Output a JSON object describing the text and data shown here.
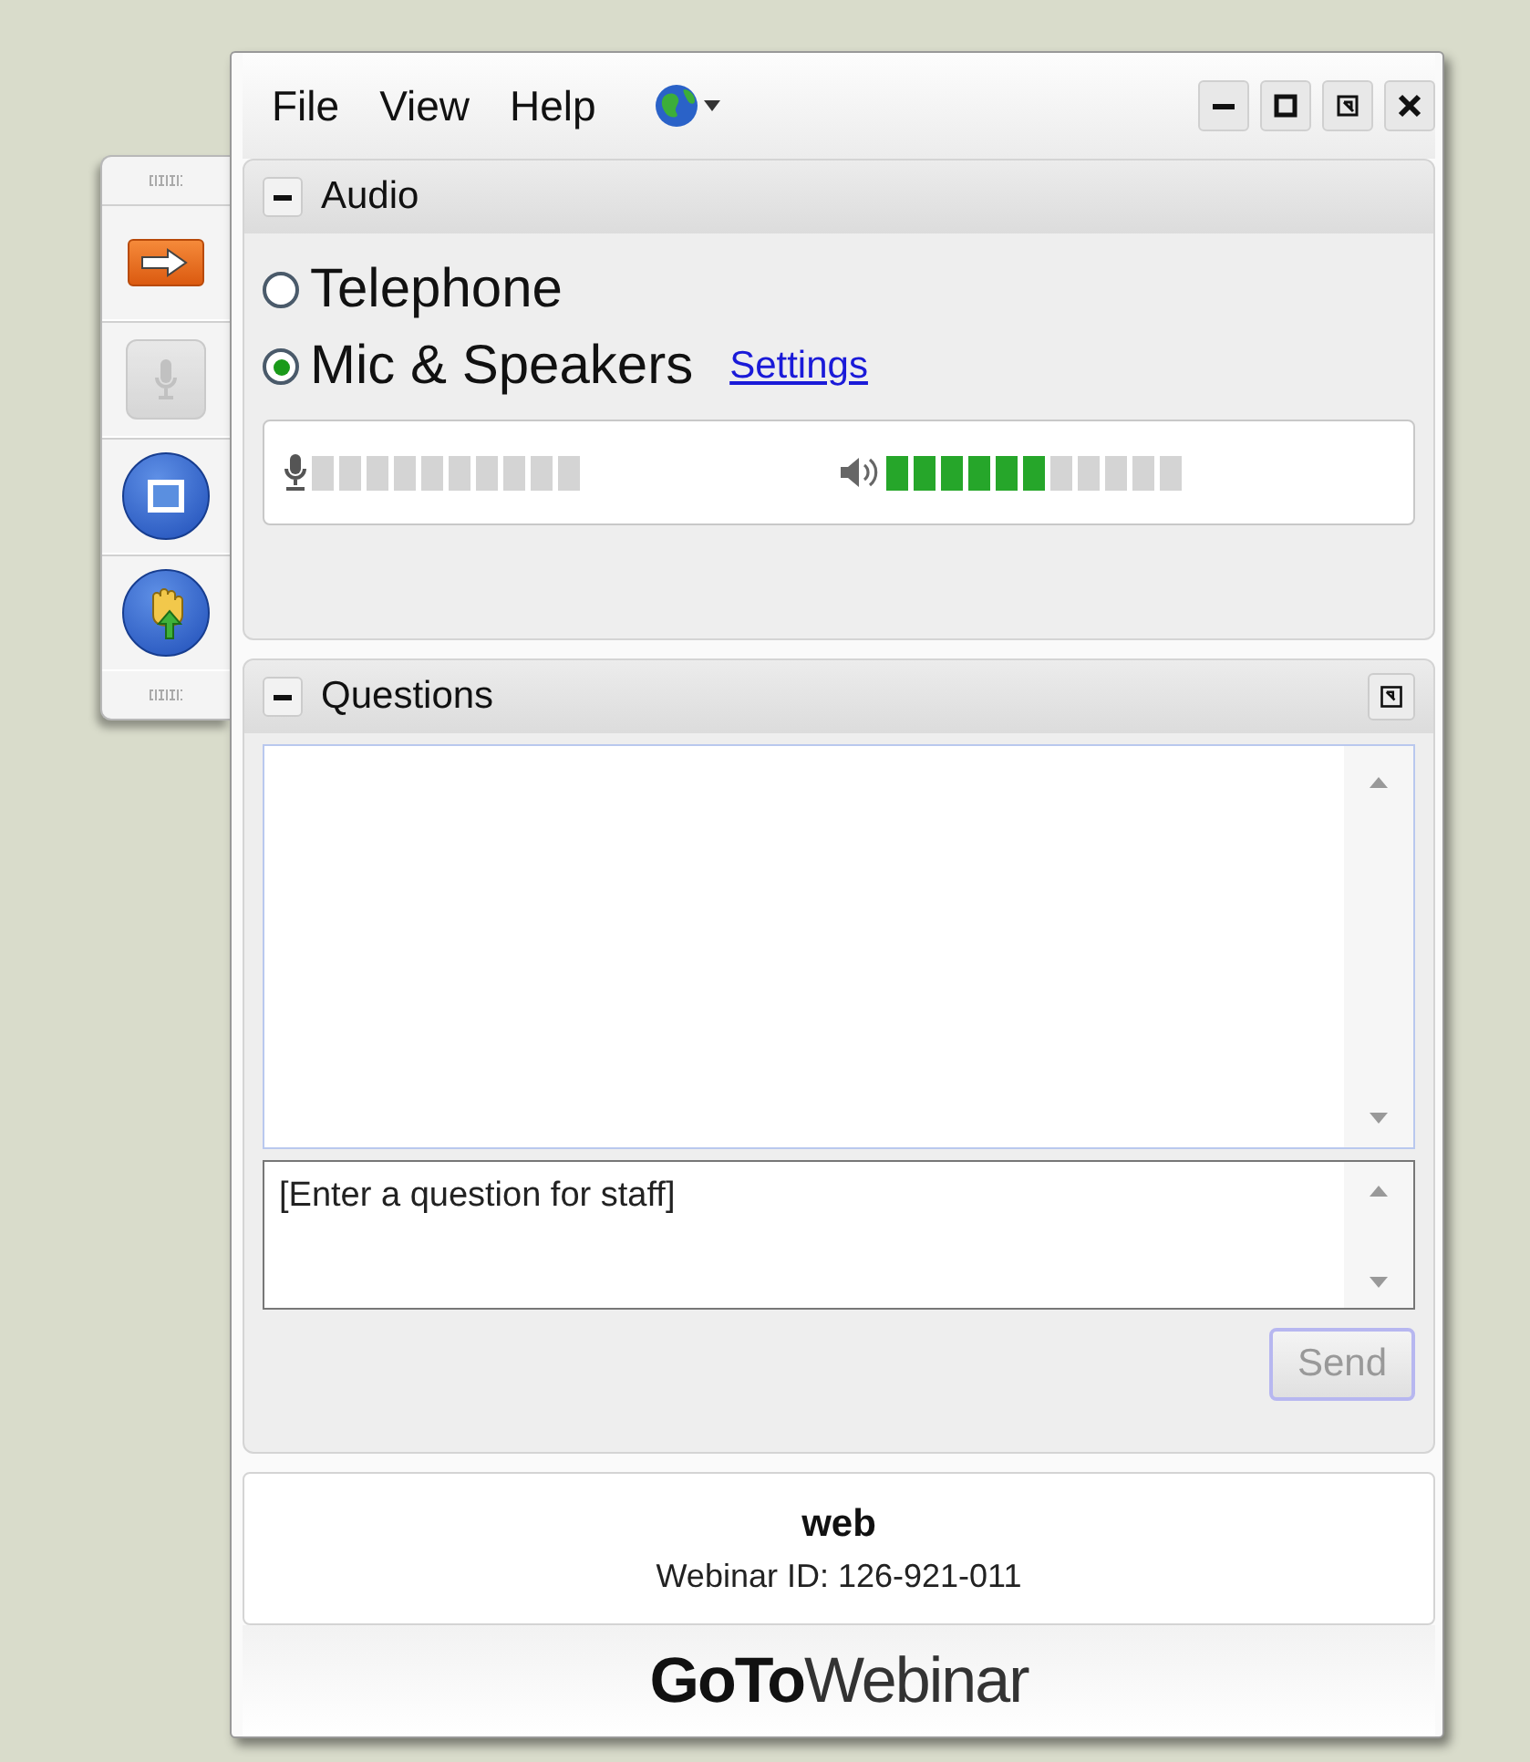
{
  "toolbar": [
    {
      "kind": "arrow",
      "disabled": false
    },
    {
      "kind": "mic",
      "disabled": true
    },
    {
      "kind": "screen",
      "disabled": false
    },
    {
      "kind": "hand",
      "disabled": false
    }
  ],
  "menu": [
    {
      "label": "File"
    },
    {
      "label": "View"
    },
    {
      "label": "Help"
    }
  ],
  "audio": {
    "title": "Audio",
    "options": [
      {
        "label": "Telephone",
        "selected": false
      },
      {
        "label": "Mic & Speakers",
        "selected": true
      }
    ],
    "settings_link": "Settings",
    "speaker_meter": {
      "level": 0.545
    }
  },
  "questions": {
    "title": "Questions",
    "input_value": "[Enter a question for staff]",
    "send_button": {
      "label": "Send",
      "disabled": true
    }
  },
  "info": {
    "name": "web",
    "webinar_id": "Webinar ID: 126-921-011"
  },
  "brand": {
    "bold": "GoTo",
    "light": "Webinar"
  }
}
